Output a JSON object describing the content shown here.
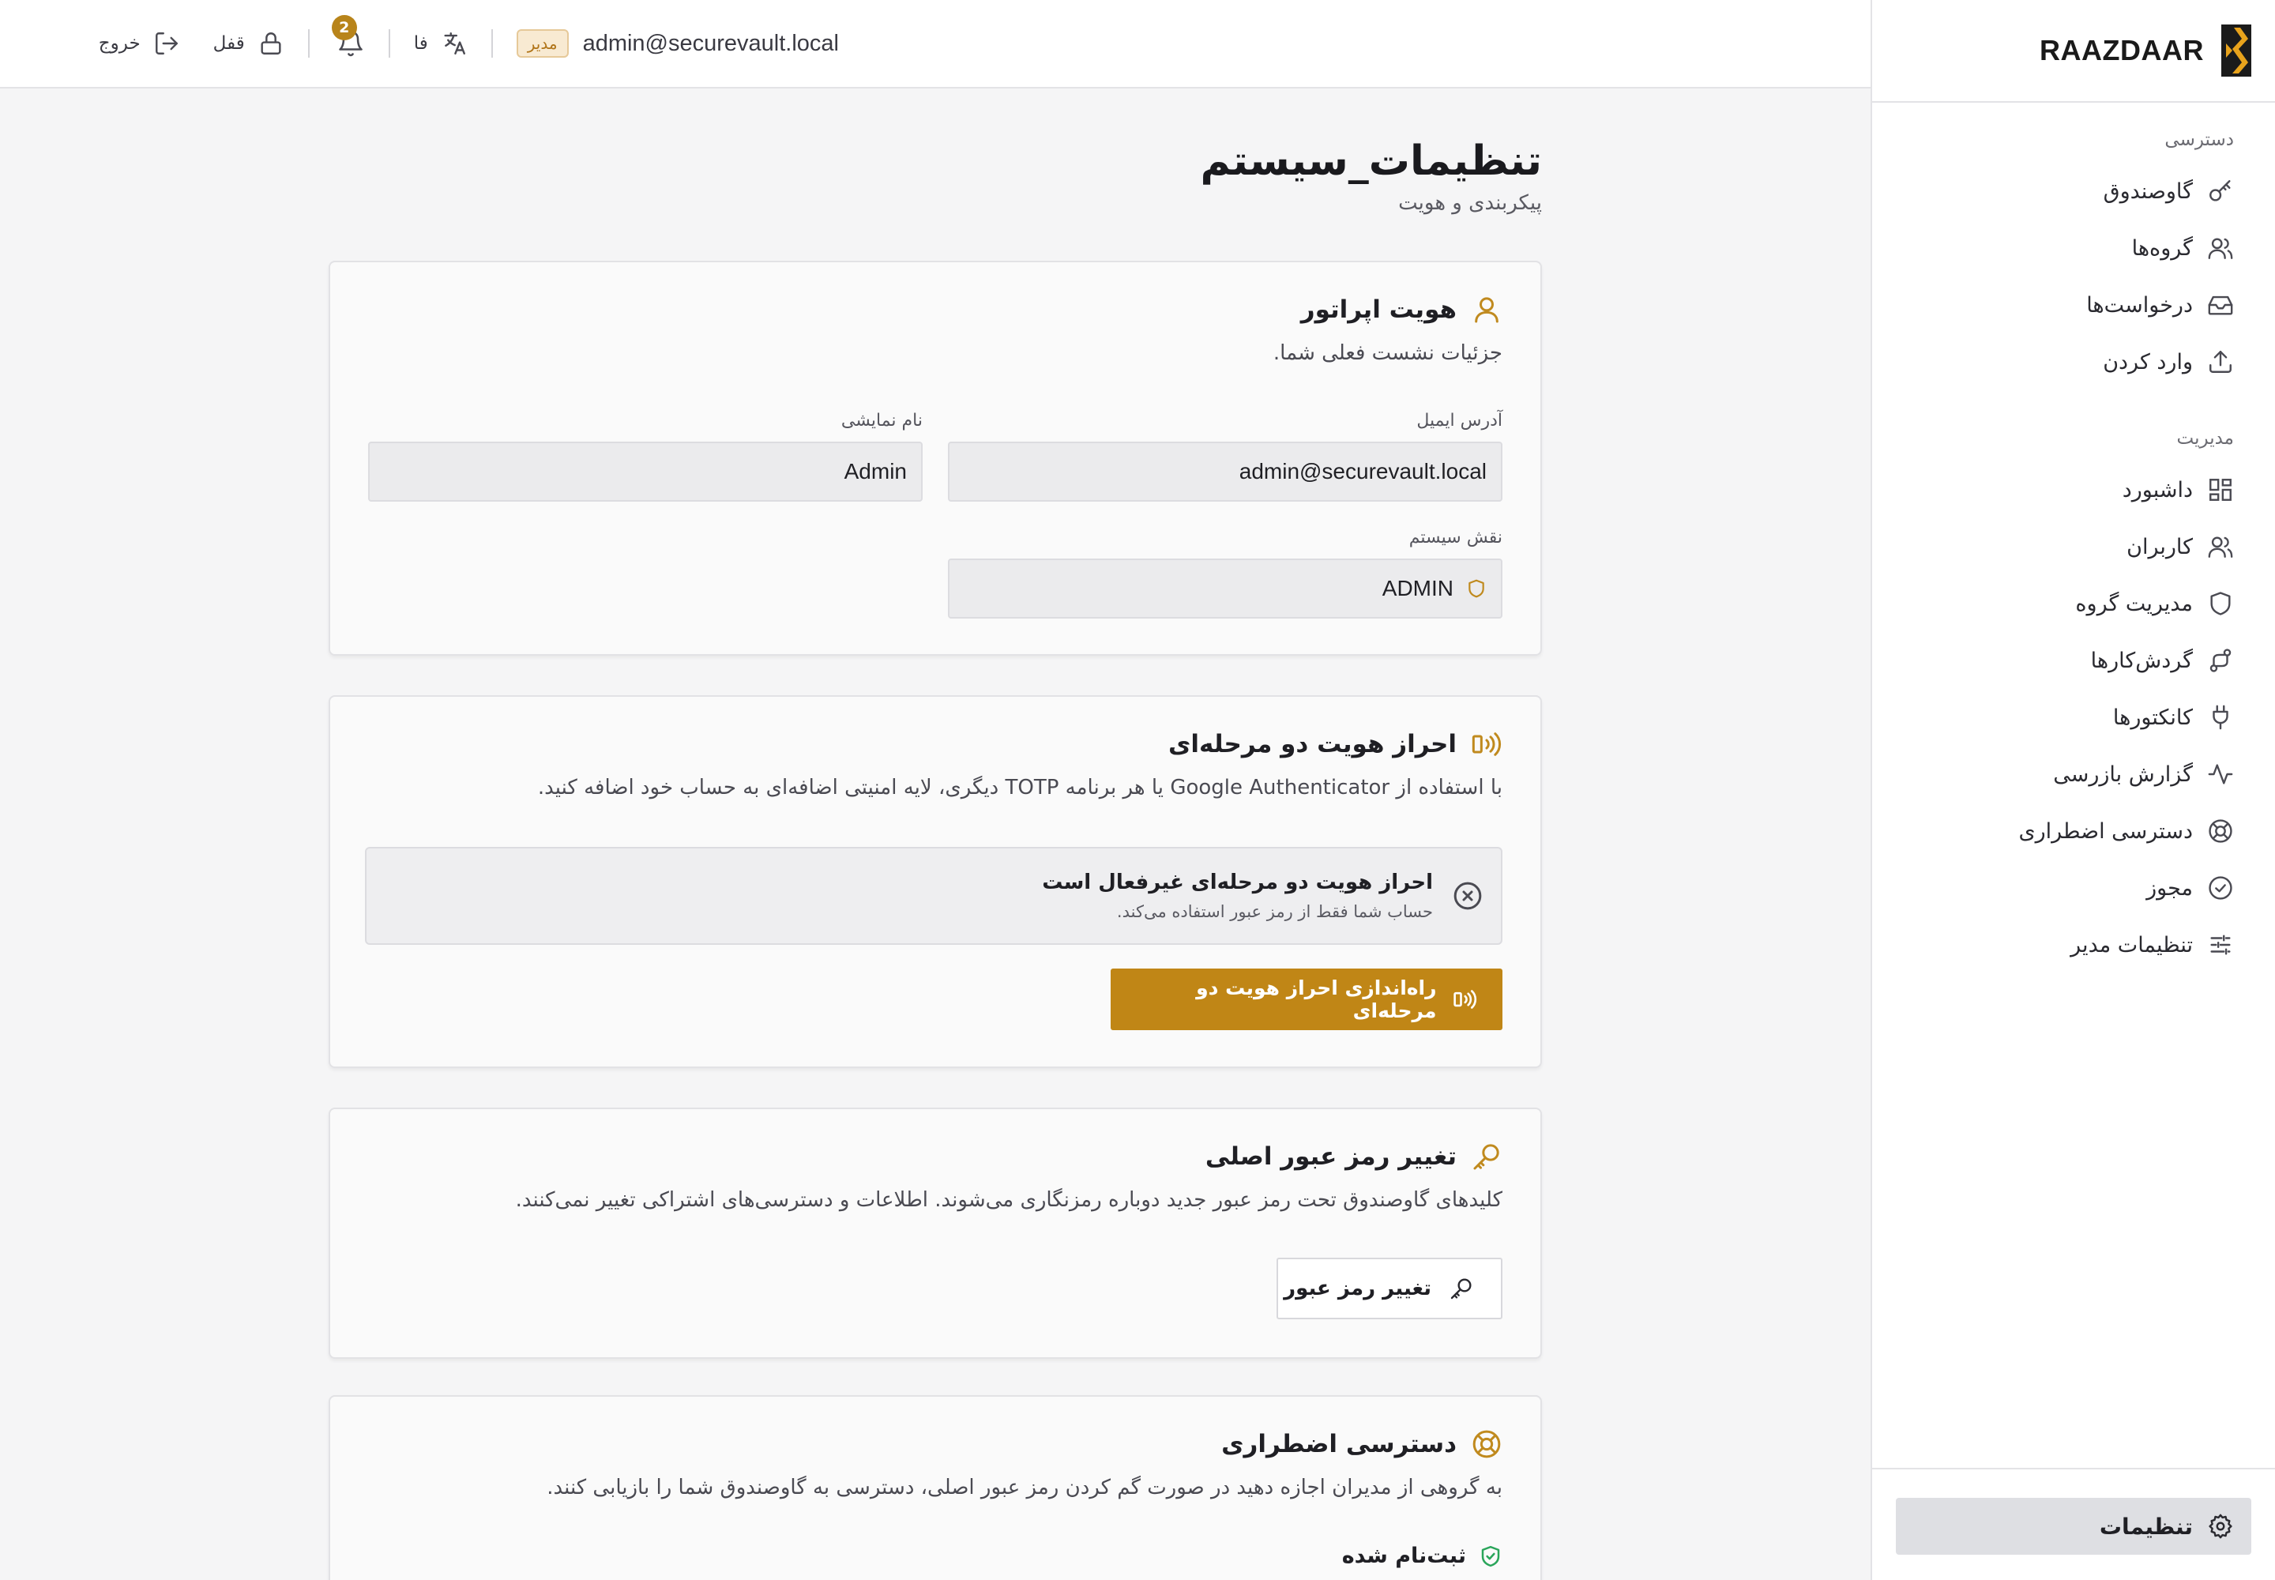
{
  "brand": {
    "name": "RAAZDAAR",
    "logo_colors": [
      "#1b1b1b",
      "#e8a31c"
    ]
  },
  "sidebar": {
    "section_access": "دسترسی",
    "access_items": [
      {
        "label": "گاوصندوق",
        "icon": "key-icon"
      },
      {
        "label": "گروه‌ها",
        "icon": "users-icon"
      },
      {
        "label": "درخواست‌ها",
        "icon": "inbox-icon"
      },
      {
        "label": "وارد کردن",
        "icon": "upload-icon"
      }
    ],
    "section_admin": "مدیریت",
    "admin_items": [
      {
        "label": "داشبورد",
        "icon": "dashboard-icon"
      },
      {
        "label": "کاربران",
        "icon": "users-icon"
      },
      {
        "label": "مدیریت گروه",
        "icon": "shield-icon"
      },
      {
        "label": "گردش‌کارها",
        "icon": "workflow-icon"
      },
      {
        "label": "کانکتورها",
        "icon": "plug-icon"
      },
      {
        "label": "گزارش بازرسی",
        "icon": "activity-icon"
      },
      {
        "label": "دسترسی اضطراری",
        "icon": "lifebuoy-icon"
      },
      {
        "label": "مجوز",
        "icon": "badge-check-icon"
      },
      {
        "label": "تنظیمات مدیر",
        "icon": "sliders-icon"
      }
    ],
    "active_item": {
      "label": "تنظیمات",
      "icon": "gear-icon"
    }
  },
  "topbar": {
    "email": "admin@securevault.local",
    "role_badge": "مدیر",
    "language": "فا",
    "notifications_count": "2",
    "lock_label": "قفل",
    "logout_label": "خروج"
  },
  "page": {
    "title": "تنظیمات_سیستم",
    "subtitle": "پیکربندی و هویت"
  },
  "identity_card": {
    "title": "هویت اپراتور",
    "description": "جزئیات نشست فعلی شما.",
    "email_label": "آدرس ایمیل",
    "email_value": "admin@securevault.local",
    "display_name_label": "نام نمایشی",
    "display_name_value": "Admin",
    "role_label": "نقش سیستم",
    "role_value": "ADMIN"
  },
  "twofa_card": {
    "title": "احراز هویت دو مرحله‌ای",
    "description": "با استفاده از Google Authenticator یا هر برنامه TOTP دیگری، لایه امنیتی اضافه‌ای به حساب خود اضافه کنید.",
    "status_title": "احراز هویت دو مرحله‌ای غیرفعال است",
    "status_subtitle": "حساب شما فقط از رمز عبور استفاده می‌کند.",
    "setup_button": "راه‌اندازی احراز هویت دو مرحله‌ای"
  },
  "password_card": {
    "title": "تغییر رمز عبور اصلی",
    "description": "کلیدهای گاوصندوق تحت رمز عبور جدید دوباره رمزنگاری می‌شوند. اطلاعات و دسترسی‌های اشتراکی تغییر نمی‌کنند.",
    "button": "تغییر رمز عبور"
  },
  "emergency_card": {
    "title": "دسترسی اضطراری",
    "description": "به گروهی از مدیران اجازه دهید در صورت گم کردن رمز عبور اصلی، دسترسی به گاوصندوق شما را بازیابی کنند.",
    "status": "ثبت‌نام شده"
  },
  "colors": {
    "accent": "#c08616",
    "success": "#2aa55a"
  }
}
